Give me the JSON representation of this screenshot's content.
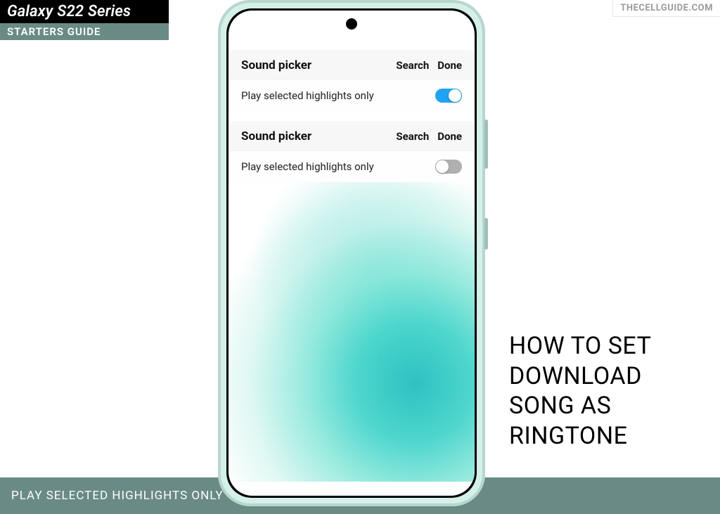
{
  "badge": {
    "brand": "Galaxy S22 Series",
    "subtitle": "STARTERS GUIDE"
  },
  "watermark": "THECELLGUIDE.COM",
  "bottom_strip": "PLAY SELECTED HIGHLIGHTS ONLY",
  "headline": "HOW TO SET DOWNLOAD SONG AS RINGTONE",
  "panels": [
    {
      "title": "Sound picker",
      "actions": {
        "search": "Search",
        "done": "Done"
      },
      "row_label": "Play selected highlights only",
      "toggle_on": true
    },
    {
      "title": "Sound picker",
      "actions": {
        "search": "Search",
        "done": "Done"
      },
      "row_label": "Play selected highlights only",
      "toggle_on": false
    }
  ],
  "colors": {
    "accent_bar": "#6a8b85",
    "toggle_on": "#1ea4f0",
    "toggle_off": "#b0b0b0"
  }
}
